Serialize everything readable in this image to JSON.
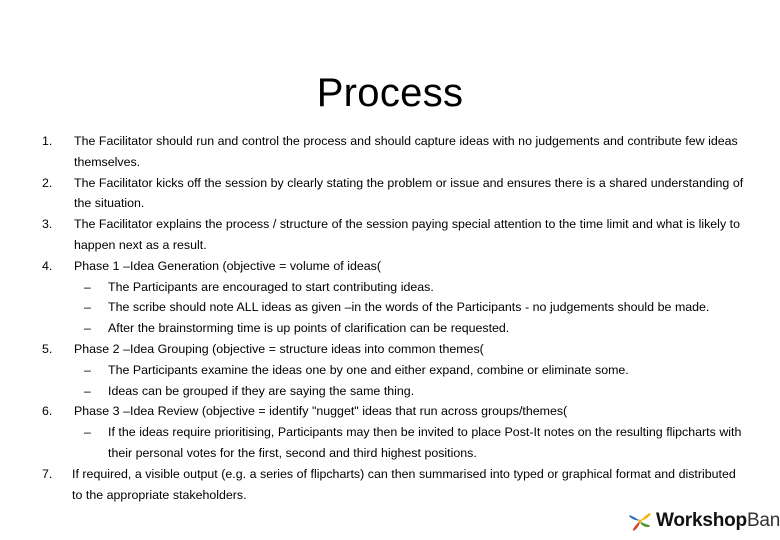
{
  "slide": {
    "title": "Process",
    "background_color": "#ffffff",
    "text_color": "#000000"
  },
  "content": {
    "items": [
      {
        "level": 1,
        "marker": "1.",
        "text": "The Facilitator should run and control the process and should capture ideas with no judgements and contribute few ideas themselves."
      },
      {
        "level": 1,
        "marker": "2.",
        "text": "The Facilitator kicks off the session by clearly stating the problem or issue and ensures there is a shared understanding of the situation."
      },
      {
        "level": 1,
        "marker": "3.",
        "text": "The Facilitator explains the process / structure of the session paying special attention to the time limit and what is likely to happen next as a result."
      },
      {
        "level": 1,
        "marker": "4.",
        "text": "Phase 1  –Idea Generation (objective = volume of ideas("
      },
      {
        "level": 2,
        "marker": "–",
        "text": "The Participants are encouraged to start contributing ideas."
      },
      {
        "level": 2,
        "marker": "–",
        "text": "The scribe should note ALL ideas as given  –in the words of the Participants - no judgements should be made."
      },
      {
        "level": 2,
        "marker": "–",
        "text": "After the brainstorming time is up points of clarification can be requested."
      },
      {
        "level": 1,
        "marker": "5.",
        "text": "Phase 2  –Idea Grouping (objective = structure ideas into common themes("
      },
      {
        "level": 2,
        "marker": "–",
        "text": "The Participants examine the ideas one by one and either expand, combine or eliminate some."
      },
      {
        "level": 2,
        "marker": "–",
        "text": "Ideas can be grouped if they are saying the same thing."
      },
      {
        "level": 1,
        "marker": "6.",
        "text": "Phase 3  –Idea Review (objective = identify \"nugget\" ideas that run across groups/themes("
      },
      {
        "level": 2,
        "marker": "–",
        "text": "If the ideas require prioritising, Participants may then be invited to place Post-It notes on the resulting flipcharts with their personal votes for the first, second and third highest positions."
      },
      {
        "level": 1,
        "marker": "7.",
        "tight": true,
        "text": "If required, a visible output (e.g. a series of flipcharts) can then summarised into typed or graphical format and distributed to the appropriate stakeholders."
      }
    ]
  },
  "logo": {
    "name": "workshopbank-logo",
    "text_bold": "Workshop",
    "text_regular": "Bank",
    "mark_colors": {
      "top_left": "#2f6fbf",
      "top_right": "#f2b705",
      "bottom_left": "#d64225",
      "bottom_right": "#4f9a2f"
    }
  }
}
